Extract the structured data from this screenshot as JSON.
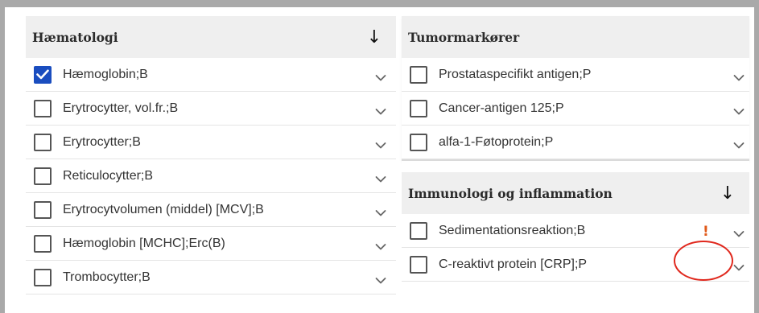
{
  "haematologi": {
    "title": "Hæmatologi",
    "items": [
      {
        "label": "Hæmoglobin;B",
        "checked": true
      },
      {
        "label": "Erytrocytter, vol.fr.;B",
        "checked": false
      },
      {
        "label": "Erytrocytter;B",
        "checked": false
      },
      {
        "label": "Reticulocytter;B",
        "checked": false
      },
      {
        "label": "Erytrocytvolumen (middel) [MCV];B",
        "checked": false
      },
      {
        "label": "Hæmoglobin [MCHC];Erc(B)",
        "checked": false
      },
      {
        "label": "Trombocytter;B",
        "checked": false
      }
    ]
  },
  "tumormarkorer": {
    "title": "Tumormarkører",
    "items": [
      {
        "label": "Prostataspecifikt antigen;P",
        "checked": false
      },
      {
        "label": "Cancer-antigen 125;P",
        "checked": false
      },
      {
        "label": "alfa-1-Føtoprotein;P",
        "checked": false
      }
    ]
  },
  "immunologi": {
    "title": "Immunologi og inflammation",
    "items": [
      {
        "label": "Sedimentationsreaktion;B",
        "checked": false,
        "warning": "!"
      },
      {
        "label": "C-reaktivt protein [CRP];P",
        "checked": false
      }
    ]
  },
  "icons": {
    "sort": "↓",
    "expand": "chevron-down-icon",
    "warning": "exclamation-icon"
  },
  "colors": {
    "checked": "#1a4dbf",
    "warning": "#e05a1a",
    "highlight_circle": "#e0281d"
  }
}
